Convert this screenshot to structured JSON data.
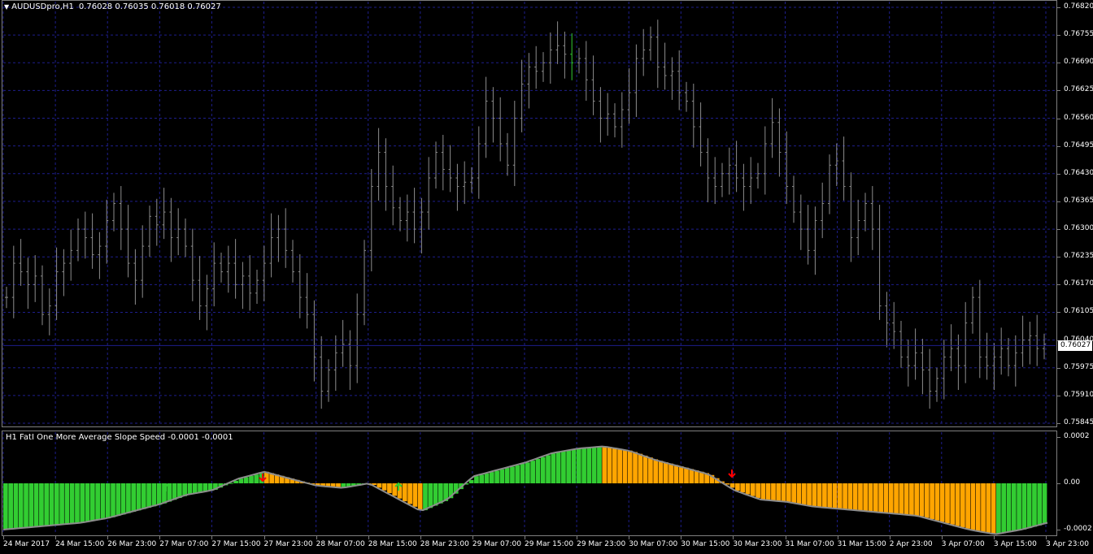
{
  "chart_header": {
    "symbol": "AUDUSDpro,H1",
    "ohlc": "0.76028 0.76035 0.76018 0.76027"
  },
  "indicator_header": {
    "title": "H1 FatI One More Average Slope Speed -0.0001 -0.0001"
  },
  "colors": {
    "background": "#000000",
    "grid": "#1e1e8c",
    "bar": "#8c8c8c",
    "bull_bar": "#32cd32",
    "hist_up": "#32cd32",
    "hist_down": "#ffa500",
    "slope_line": "#8c8c8c",
    "arrow_up": "#32cd32",
    "arrow_down": "#ff0000",
    "price_line": "#1e1e8c"
  },
  "price_axis": {
    "labels": [
      "0.76820",
      "0.76755",
      "0.76690",
      "0.76625",
      "0.76560",
      "0.76495",
      "0.76430",
      "0.76365",
      "0.76300",
      "0.76235",
      "0.76170",
      "0.76105",
      "0.76040",
      "0.75975",
      "0.75910",
      "0.75845"
    ],
    "current": "0.76027"
  },
  "indicator_axis": {
    "labels": [
      "0.0002",
      "0.00",
      "-0.0002"
    ]
  },
  "time_axis": {
    "labels": [
      "24 Mar 2017",
      "24 Mar 15:00",
      "26 Mar 23:00",
      "27 Mar 07:00",
      "27 Mar 15:00",
      "27 Mar 23:00",
      "28 Mar 07:00",
      "28 Mar 15:00",
      "28 Mar 23:00",
      "29 Mar 07:00",
      "29 Mar 15:00",
      "29 Mar 23:00",
      "30 Mar 07:00",
      "30 Mar 15:00",
      "30 Mar 23:00",
      "31 Mar 07:00",
      "31 Mar 15:00",
      "2 Apr 23:00",
      "3 Apr 07:00",
      "3 Apr 15:00",
      "3 Apr 23:00"
    ]
  },
  "chart_data": {
    "type": "bar",
    "series_closes": [
      0.7614,
      0.7622,
      0.762,
      0.7617,
      0.7619,
      0.761,
      0.7612,
      0.762,
      0.7622,
      0.7625,
      0.763,
      0.7628,
      0.7624,
      0.7626,
      0.7632,
      0.7636,
      0.763,
      0.7622,
      0.7618,
      0.7626,
      0.7633,
      0.7631,
      0.7634,
      0.7628,
      0.763,
      0.7626,
      0.7618,
      0.7612,
      0.7616,
      0.7622,
      0.762,
      0.7622,
      0.7617,
      0.7619,
      0.7615,
      0.7618,
      0.7622,
      0.7628,
      0.763,
      0.7625,
      0.762,
      0.7614,
      0.761,
      0.76,
      0.7592,
      0.7597,
      0.7601,
      0.7603,
      0.7598,
      0.761,
      0.7625,
      0.764,
      0.7648,
      0.764,
      0.7635,
      0.7632,
      0.7634,
      0.763,
      0.7634,
      0.7642,
      0.7648,
      0.7644,
      0.7642,
      0.764,
      0.7641,
      0.7642,
      0.765,
      0.766,
      0.7656,
      0.765,
      0.7645,
      0.7656,
      0.7664,
      0.7668,
      0.7667,
      0.7669,
      0.7672,
      0.7673,
      0.7671,
      0.7669,
      0.767,
      0.7665,
      0.766,
      0.7656,
      0.7657,
      0.7654,
      0.7658,
      0.7662,
      0.767,
      0.7672,
      0.7675,
      0.7668,
      0.7666,
      0.7667,
      0.7662,
      0.766,
      0.7654,
      0.7648,
      0.7642,
      0.764,
      0.7643,
      0.7645,
      0.7642,
      0.764,
      0.7642,
      0.7643,
      0.765,
      0.7655,
      0.7648,
      0.764,
      0.7634,
      0.763,
      0.7625,
      0.7632,
      0.7636,
      0.7645,
      0.7646,
      0.764,
      0.7628,
      0.7632,
      0.7636,
      0.763,
      0.7612,
      0.7608,
      0.7606,
      0.76,
      0.7598,
      0.7601,
      0.7597,
      0.7592,
      0.7595,
      0.76,
      0.7602,
      0.7598,
      0.7608,
      0.7614,
      0.76,
      0.7598,
      0.76,
      0.7602,
      0.7598,
      0.7601,
      0.7604,
      0.7605,
      0.7602,
      0.7603
    ],
    "indicator_slope": [
      -0.0002,
      -0.00019,
      -0.00018,
      -0.00017,
      -0.00015,
      -0.00012,
      -9e-05,
      -5e-05,
      -3e-05,
      2e-05,
      5e-05,
      2e-05,
      -1e-05,
      -2e-05,
      0.0,
      -6e-05,
      -0.00012,
      -7e-05,
      3e-05,
      6e-05,
      9e-05,
      0.00013,
      0.00015,
      0.00016,
      0.00014,
      0.0001,
      7e-05,
      4e-05,
      -3e-05,
      -7e-05,
      -8e-05,
      -0.0001,
      -0.00011,
      -0.00012,
      -0.00013,
      -0.00014,
      -0.00017,
      -0.0002,
      -0.00022,
      -0.0002,
      -0.00017
    ]
  }
}
